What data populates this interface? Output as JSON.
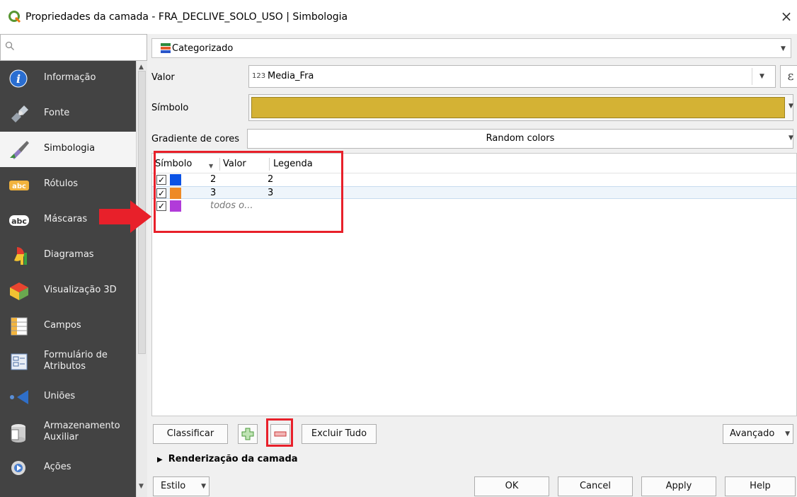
{
  "window": {
    "title": "Propriedades da camada - FRA_DECLIVE_SOLO_USO | Simbologia",
    "close_glyph": "×"
  },
  "search": {
    "placeholder": ""
  },
  "sidebar": {
    "items": [
      {
        "label": "Informação",
        "icon": "info-icon"
      },
      {
        "label": "Fonte",
        "icon": "source-icon"
      },
      {
        "label": "Simbologia",
        "icon": "symbology-icon"
      },
      {
        "label": "Rótulos",
        "icon": "labels-icon",
        "badge": "abc"
      },
      {
        "label": "Máscaras",
        "icon": "masks-icon",
        "badge": "abc"
      },
      {
        "label": "Diagramas",
        "icon": "diagrams-icon"
      },
      {
        "label": "Visualização 3D",
        "icon": "3d-view-icon"
      },
      {
        "label": "Campos",
        "icon": "fields-icon"
      },
      {
        "label_line1": "Formulário de",
        "label_line2": "Atributos",
        "icon": "attributes-form-icon"
      },
      {
        "label": "Uniões",
        "icon": "joins-icon"
      },
      {
        "label_line1": "Armazenamento",
        "label_line2": "Auxiliar",
        "icon": "auxiliary-storage-icon"
      },
      {
        "label": "Ações",
        "icon": "actions-icon"
      }
    ],
    "selected": "Simbologia"
  },
  "renderer": {
    "value": "Categorizado"
  },
  "form": {
    "value_label": "Valor",
    "value_type_glyph": "123",
    "value_field": "Media_Fra",
    "expression_glyph": "ε",
    "symbol_label": "Símbolo",
    "symbol_color": "#d4b234",
    "ramp_label": "Gradiente de cores",
    "ramp_value": "Random colors"
  },
  "table": {
    "headers": [
      "Símbolo",
      "Valor",
      "Legenda"
    ],
    "rows": [
      {
        "checked": true,
        "color": "#0b53e5",
        "value": "2",
        "legend": "2"
      },
      {
        "checked": true,
        "color": "#ee8a26",
        "value": "3",
        "legend": "3"
      },
      {
        "checked": true,
        "color": "#b13bd9",
        "value": "todos o...",
        "legend": ""
      }
    ],
    "check_glyph": "✓"
  },
  "buttons": {
    "classify": "Classificar",
    "delete_all": "Excluir Tudo",
    "advanced": "Avançado",
    "style": "Estilo",
    "ok": "OK",
    "cancel": "Cancel",
    "apply": "Apply",
    "help": "Help"
  },
  "layer_rendering": {
    "label": "Renderização da camada"
  },
  "annotations": {
    "highlight_color": "#e8202a"
  }
}
